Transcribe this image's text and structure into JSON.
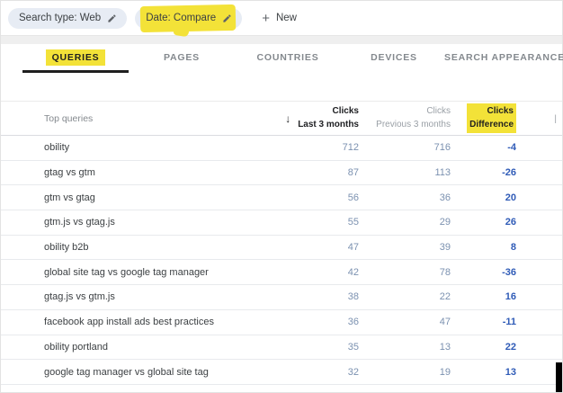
{
  "filters": {
    "search_type_chip": "Search type: Web",
    "date_chip": "Date: Compare",
    "new_button": {
      "plus": "+",
      "label": "New"
    }
  },
  "tabs": [
    {
      "label": "QUERIES"
    },
    {
      "label": "PAGES"
    },
    {
      "label": "COUNTRIES"
    },
    {
      "label": "DEVICES"
    },
    {
      "label": "SEARCH APPEARANCE"
    }
  ],
  "table": {
    "first_column_header": "Top queries",
    "sort_icon": "↓",
    "columns": {
      "clicks_last": {
        "line1": "Clicks",
        "line2": "Last 3 months"
      },
      "clicks_prev": {
        "line1": "Clicks",
        "line2": "Previous 3 months"
      },
      "clicks_diff": {
        "line1": "Clicks",
        "line2": "Difference"
      }
    },
    "next_column_clip": "|",
    "rows": [
      {
        "query": "obility",
        "clicks_last": "712",
        "clicks_prev": "716",
        "difference": "-4"
      },
      {
        "query": "gtag vs gtm",
        "clicks_last": "87",
        "clicks_prev": "113",
        "difference": "-26"
      },
      {
        "query": "gtm vs gtag",
        "clicks_last": "56",
        "clicks_prev": "36",
        "difference": "20"
      },
      {
        "query": "gtm.js vs gtag.js",
        "clicks_last": "55",
        "clicks_prev": "29",
        "difference": "26"
      },
      {
        "query": "obility b2b",
        "clicks_last": "47",
        "clicks_prev": "39",
        "difference": "8"
      },
      {
        "query": "global site tag vs google tag manager",
        "clicks_last": "42",
        "clicks_prev": "78",
        "difference": "-36"
      },
      {
        "query": "gtag.js vs gtm.js",
        "clicks_last": "38",
        "clicks_prev": "22",
        "difference": "16"
      },
      {
        "query": "facebook app install ads best practices",
        "clicks_last": "36",
        "clicks_prev": "47",
        "difference": "-11"
      },
      {
        "query": "obility portland",
        "clicks_last": "35",
        "clicks_prev": "13",
        "difference": "22"
      },
      {
        "query": "google tag manager vs global site tag",
        "clicks_last": "32",
        "clicks_prev": "19",
        "difference": "13"
      }
    ]
  },
  "colors": {
    "highlight_yellow": "#f3e238",
    "chip_background": "#e7ecf4",
    "clicks_value_blue": "#7b91b0",
    "difference_blue": "#2f5bb7",
    "tab_gray": "#84898e"
  }
}
